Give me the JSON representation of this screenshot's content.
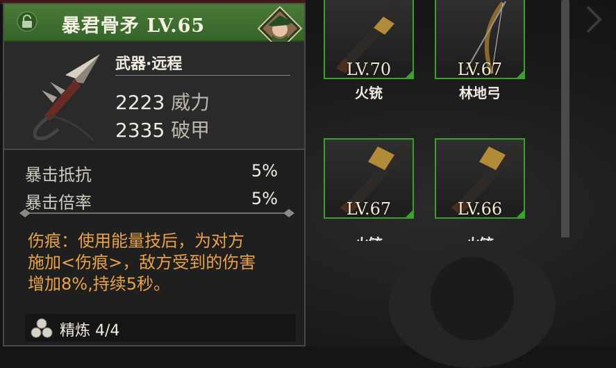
{
  "item": {
    "name": "暴君骨矛 LV.65",
    "category": "武器·远程",
    "stats": [
      {
        "value": "2223",
        "label": "威力"
      },
      {
        "value": "2335",
        "label": "破甲"
      }
    ],
    "attributes": [
      {
        "label": "暴击抵抗",
        "value": "5%"
      },
      {
        "label": "暴击倍率",
        "value": "5%"
      }
    ],
    "description_lines": [
      "伤痕：使用能量技后，为对方",
      "施加<伤痕>，敌方受到的伤害",
      "增加8%,持续5秒。"
    ],
    "refine": "精炼 4/4",
    "rarity_color": "#3f7330",
    "desc_color": "#e9a24a"
  },
  "inventory": [
    {
      "level": "LV.70",
      "name": "火铳",
      "icon": "musket-icon"
    },
    {
      "level": "LV.67",
      "name": "林地弓",
      "icon": "bow-icon"
    },
    {
      "level": "LV.67",
      "name": "火铳",
      "icon": "musket-icon"
    },
    {
      "level": "LV.66",
      "name": "火铳",
      "icon": "musket-icon"
    }
  ],
  "accent_color": "#3ba12c"
}
